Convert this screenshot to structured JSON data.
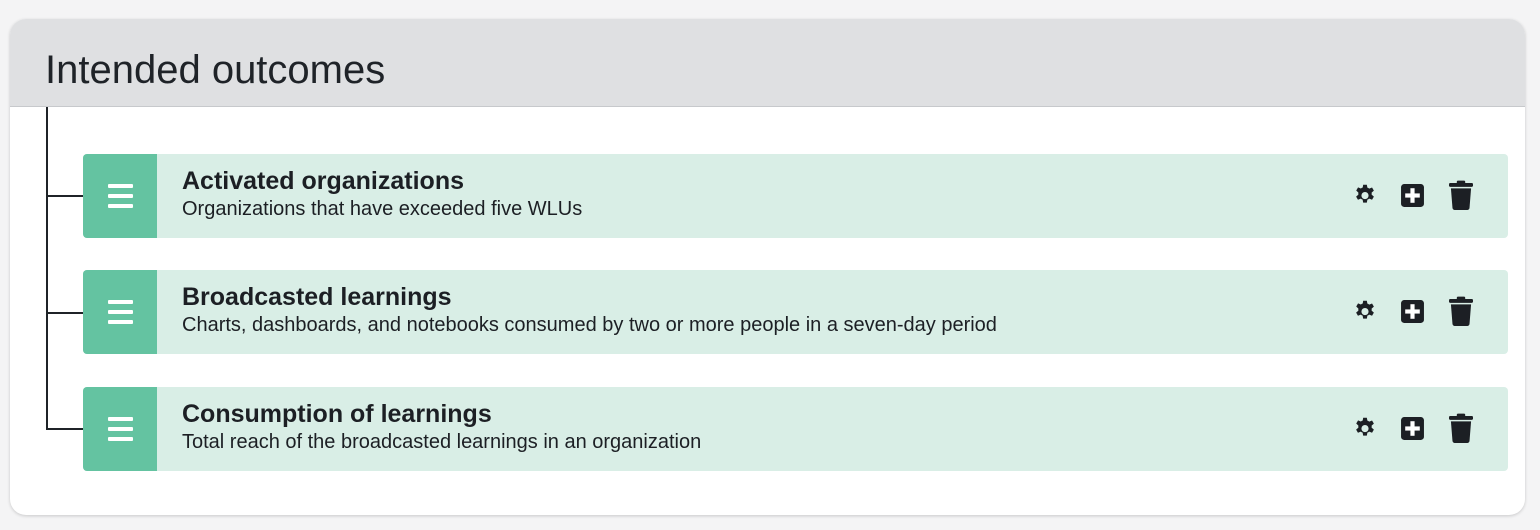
{
  "panel": {
    "title": "Intended outcomes"
  },
  "outcomes": [
    {
      "title": "Activated organizations",
      "description": "Organizations that have exceeded five WLUs"
    },
    {
      "title": "Broadcasted learnings",
      "description": "Charts, dashboards, and notebooks consumed by two or more people in a seven-day period"
    },
    {
      "title": "Consumption of learnings",
      "description": "Total reach of the broadcasted learnings in an organization"
    }
  ],
  "icons": {
    "handle": "drag-handle-icon",
    "settings": "gear-icon",
    "add": "plus-square-icon",
    "delete": "trash-icon"
  },
  "colors": {
    "header_bg": "#dfe0e2",
    "row_bg": "#d9eee6",
    "handle_bg": "#64c3a1",
    "icon": "#1c1f24"
  }
}
